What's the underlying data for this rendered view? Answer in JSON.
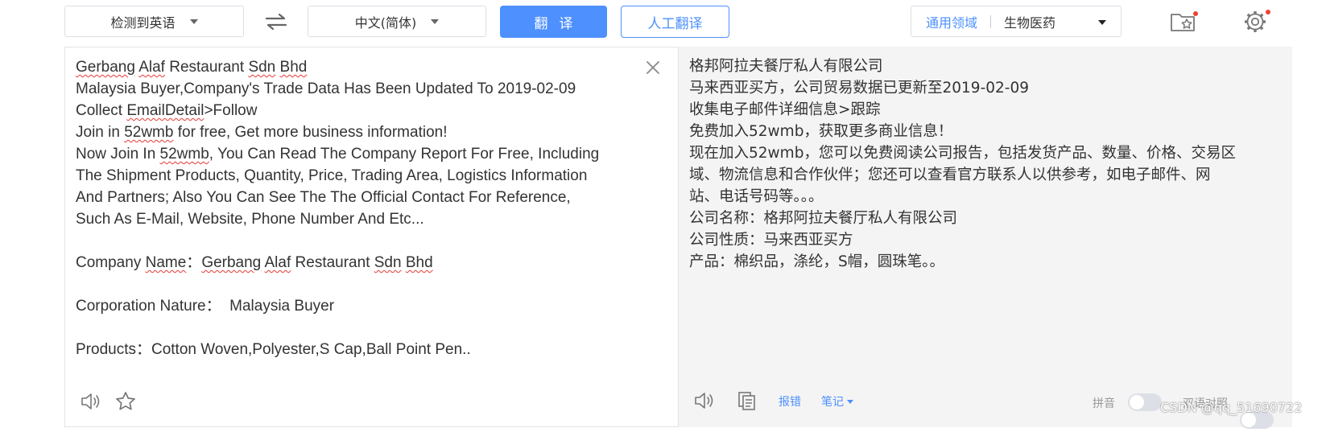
{
  "toolbar": {
    "source_lang": "检测到英语",
    "target_lang": "中文(简体)",
    "translate_label": "翻译",
    "human_translate_label": "人工翻译",
    "domain_general": "通用领域",
    "domain_selected": "生物医药"
  },
  "source": {
    "lines": [
      [
        "Gerbang",
        " ",
        "Alaf",
        " Restaurant ",
        "Sdn",
        " ",
        "Bhd"
      ],
      "Malaysia Buyer,Company's Trade Data Has Been Updated To 2019-02-09",
      [
        "Collect ",
        "EmailDetail",
        ">Follow"
      ],
      [
        "Join in ",
        "52wmb",
        " for free, Get more business information!"
      ],
      [
        "Now Join In ",
        "52wmb",
        ", You Can Read The Company Report For Free, Including"
      ],
      "The Shipment Products, Quantity, Price, Trading Area, Logistics Information",
      "And Partners; Also You Can See The The Official Contact For Reference,",
      "Such As E-Mail, Website, Phone Number And Etc...",
      "",
      [
        "Company ",
        "Name",
        "：",
        "Gerbang",
        " ",
        "Alaf",
        " Restaurant ",
        "Sdn",
        " ",
        "Bhd"
      ],
      "",
      "Corporation Nature：  Malaysia Buyer",
      "",
      "Products：Cotton Woven,Polyester,S Cap,Ball Point Pen.."
    ]
  },
  "target": {
    "lines": [
      "格邦阿拉夫餐厅私人有限公司",
      "马来西亚买方，公司贸易数据已更新至2019-02-09",
      "收集电子邮件详细信息>跟踪",
      "免费加入52wmb，获取更多商业信息！",
      "现在加入52wmb，您可以免费阅读公司报告，包括发货产品、数量、价格、交易区",
      "域、物流信息和合作伙伴；您还可以查看官方联系人以供参考，如电子邮件、网",
      "站、电话号码等。。。",
      "公司名称：格邦阿拉夫餐厅私人有限公司",
      "公司性质：马来西亚买方",
      "产品：棉织品，涤纶，S帽，圆珠笔。。"
    ],
    "report_error_label": "报错",
    "notes_label": "笔记",
    "pinyin_label": "拼音",
    "bilingual_label": "双语对照"
  },
  "watermark": "CSDN @qq_51690722",
  "colors": {
    "accent": "#4d90fe",
    "target_bg": "#f4f4f5",
    "spell_underline": "#e53935",
    "dot": "#f04134"
  }
}
